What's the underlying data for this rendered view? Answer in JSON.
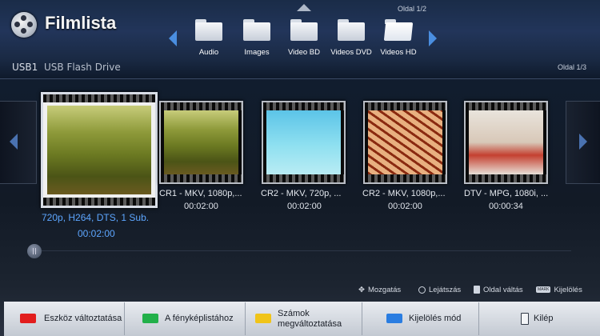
{
  "header": {
    "title": "Filmlista",
    "page_indicator": "Oldal 1/2"
  },
  "categories": [
    {
      "label": "Audio",
      "icon": "folder-icon"
    },
    {
      "label": "Images",
      "icon": "folder-icon"
    },
    {
      "label": "Video BD",
      "icon": "folder-icon"
    },
    {
      "label": "Videos DVD",
      "icon": "folder-icon"
    },
    {
      "label": "Videos HD",
      "icon": "folder-open-icon",
      "selected": true
    }
  ],
  "device": {
    "id": "USB1",
    "name": "USB Flash Drive",
    "page_indicator": "Oldal 1/3"
  },
  "files": [
    {
      "info": "720p, H264, DTS, 1 Sub.",
      "duration": "00:02:00",
      "selected": true,
      "scene": "jungle"
    },
    {
      "info": "CR1 - MKV, 1080p,...",
      "duration": "00:02:00",
      "scene": "jungle"
    },
    {
      "info": "CR2 - MKV, 720p, ...",
      "duration": "00:02:00",
      "scene": "sky"
    },
    {
      "info": "CR2 - MKV, 1080p,...",
      "duration": "00:02:00",
      "scene": "structure"
    },
    {
      "info": "DTV - MPG, 1080i, ...",
      "duration": "00:00:34",
      "scene": "tv-studio"
    }
  ],
  "hints": [
    {
      "icon": "dpad-icon",
      "label": "Mozgatás"
    },
    {
      "icon": "ok-dot-icon",
      "label": "Lejátszás"
    },
    {
      "icon": "page-icon",
      "label": "Oldal váltás"
    },
    {
      "icon": "mark-icon",
      "badge": "MARK",
      "label": "Kijelölés"
    }
  ],
  "buttons": [
    {
      "label": "Eszköz változtatása",
      "color": "#e21d1d"
    },
    {
      "label": "A fényképlistához",
      "color": "#22b04a"
    },
    {
      "label": "Számok megváltoztatása",
      "line1": "Számok",
      "line2": "megváltoztatása",
      "color": "#f0c419"
    },
    {
      "label": "Kijelölés mód",
      "color": "#2a7de1"
    },
    {
      "label": "Kilép",
      "icon": "exit-icon"
    }
  ]
}
